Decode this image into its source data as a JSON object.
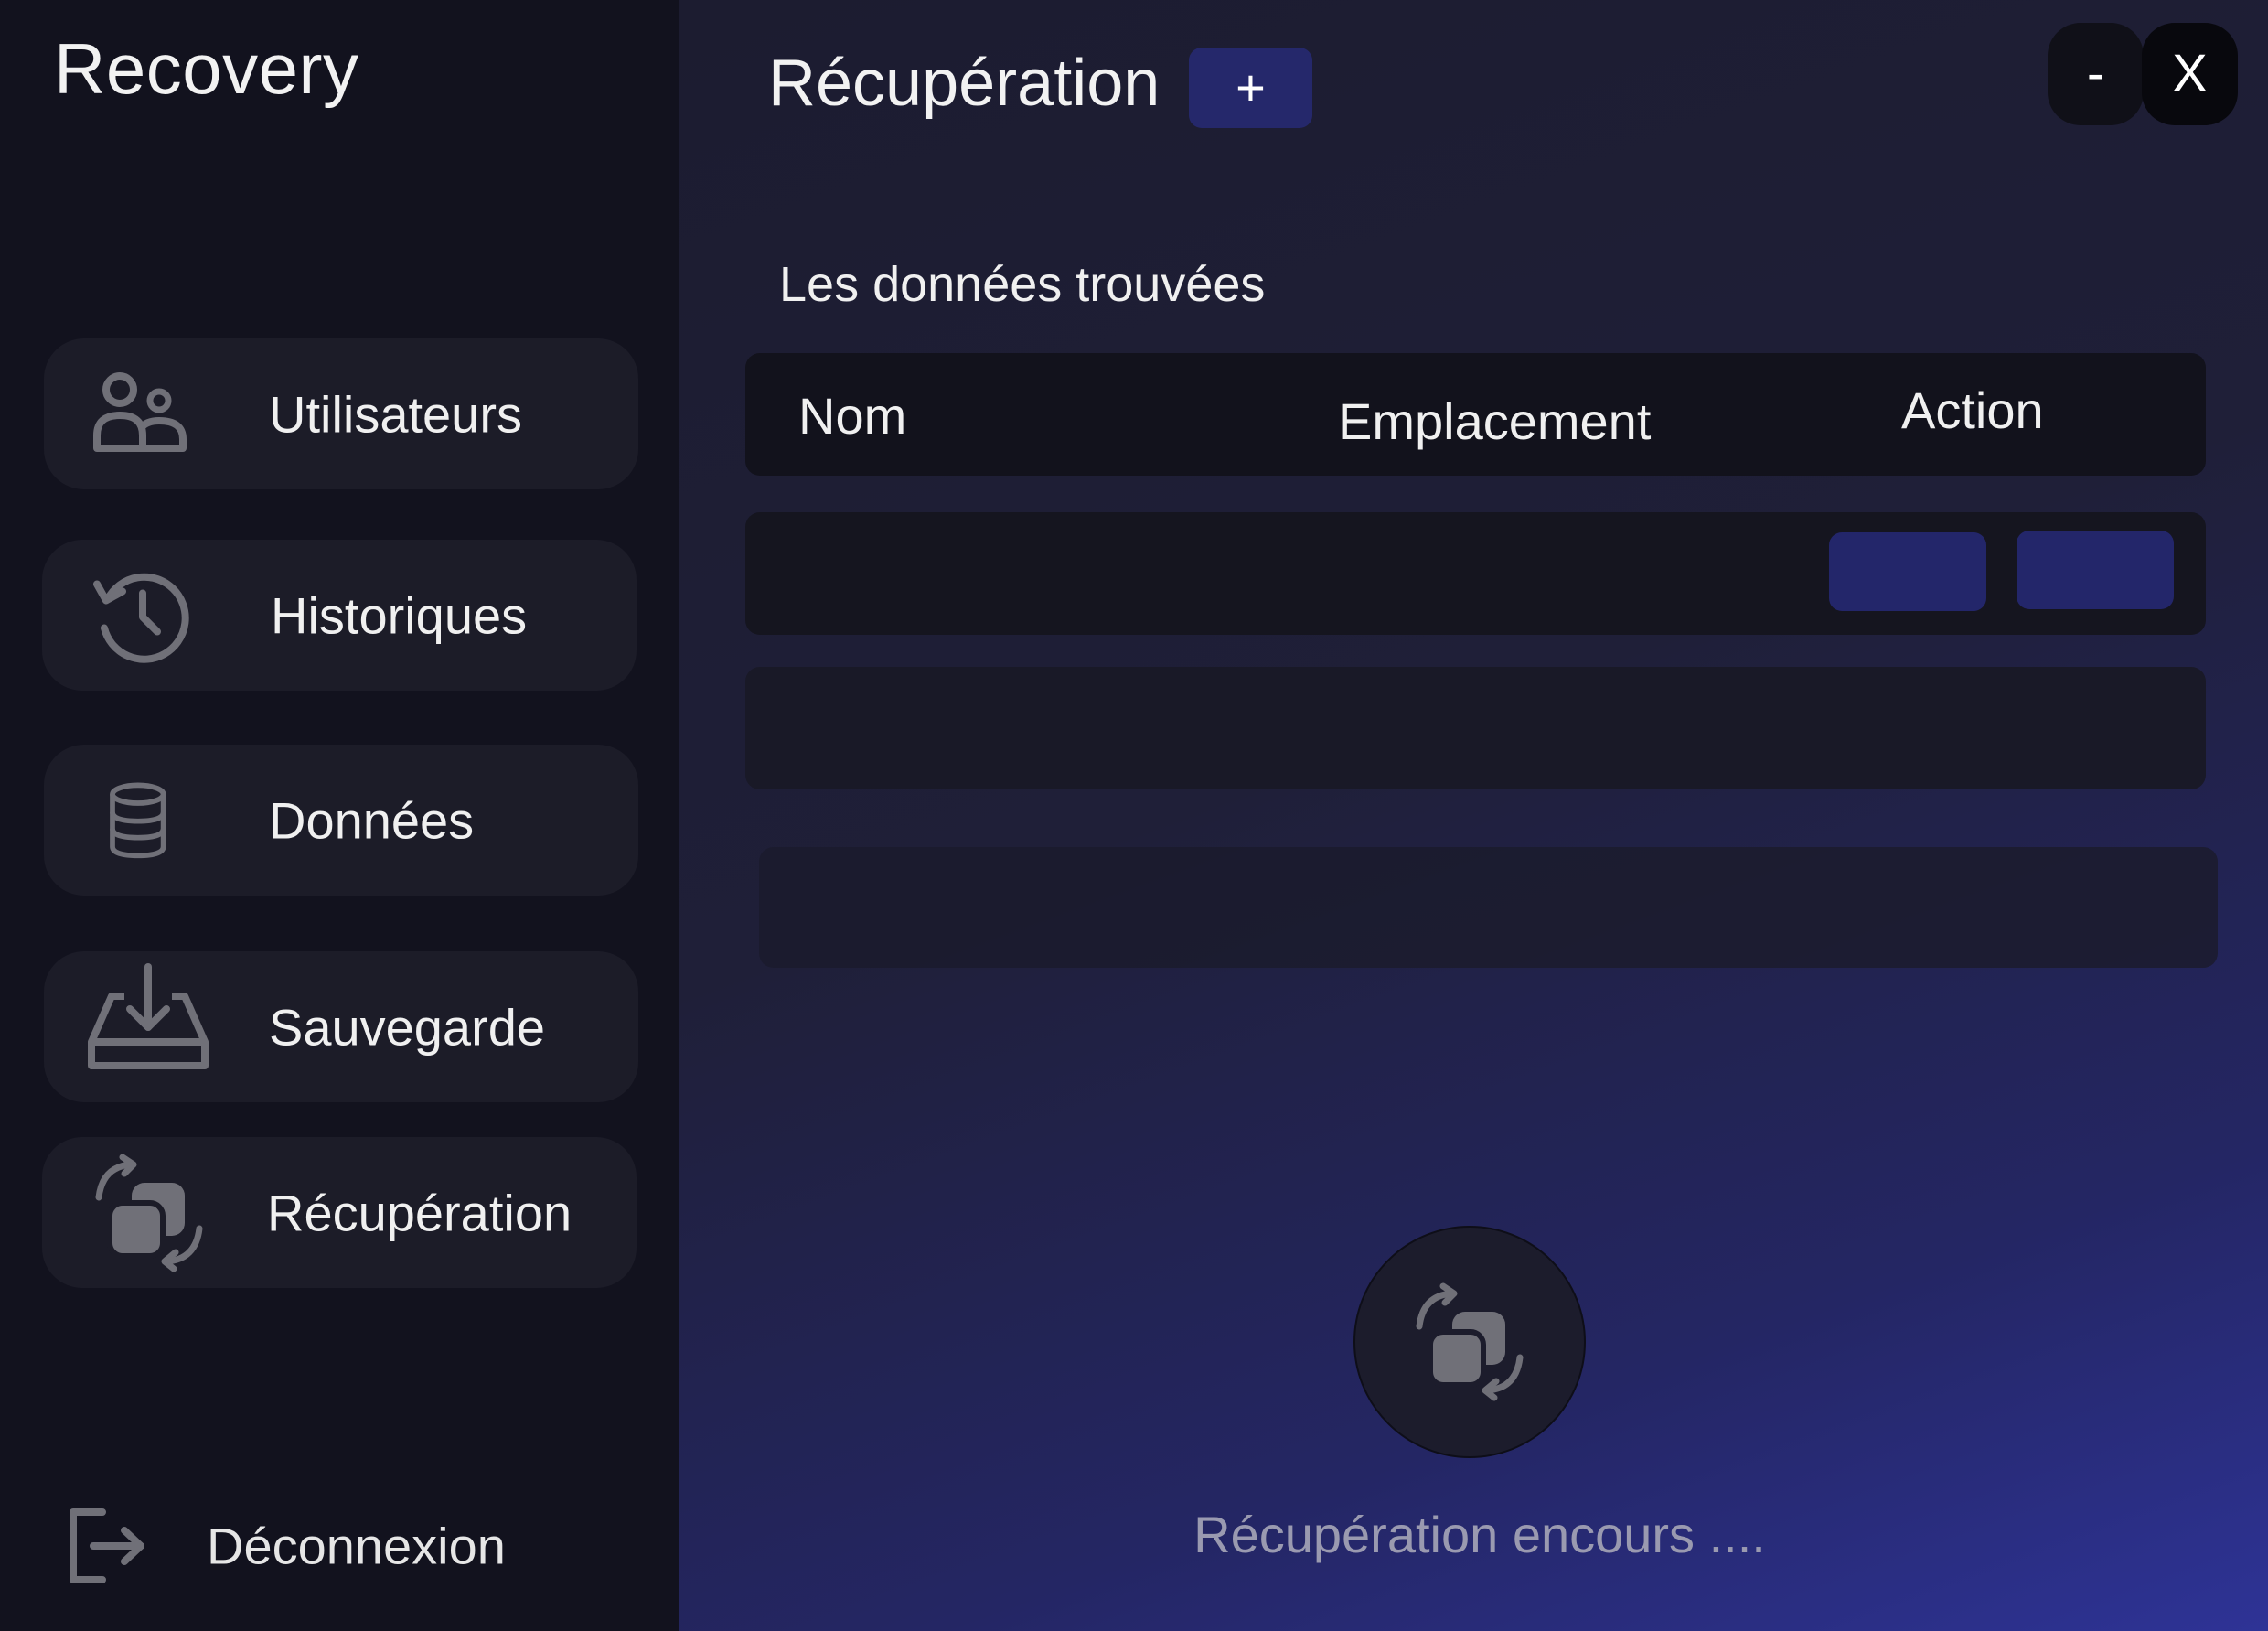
{
  "sidebar": {
    "app_title": "Recovery",
    "items": [
      {
        "label": "Utilisateurs",
        "icon": "users-icon"
      },
      {
        "label": "Historiques",
        "icon": "history-icon"
      },
      {
        "label": "Données",
        "icon": "database-icon"
      },
      {
        "label": "Sauvegarde",
        "icon": "download-tray-icon"
      },
      {
        "label": "Récupération",
        "icon": "recovery-icon"
      }
    ],
    "logout_label": "Déconnexion"
  },
  "header": {
    "title": "Récupération",
    "add_label": "+",
    "minimize_label": "-",
    "close_label": "X"
  },
  "table": {
    "section_title": "Les données trouvées",
    "columns": [
      "Nom",
      "Emplacement",
      "Action"
    ]
  },
  "status": {
    "text": "Récupération encours ...."
  },
  "colors": {
    "sidebar_bg": "#12121e",
    "card_bg": "#1c1c28",
    "accent": "#25286b",
    "gradient_end": "#2e3396",
    "icon_gray": "#707078"
  }
}
